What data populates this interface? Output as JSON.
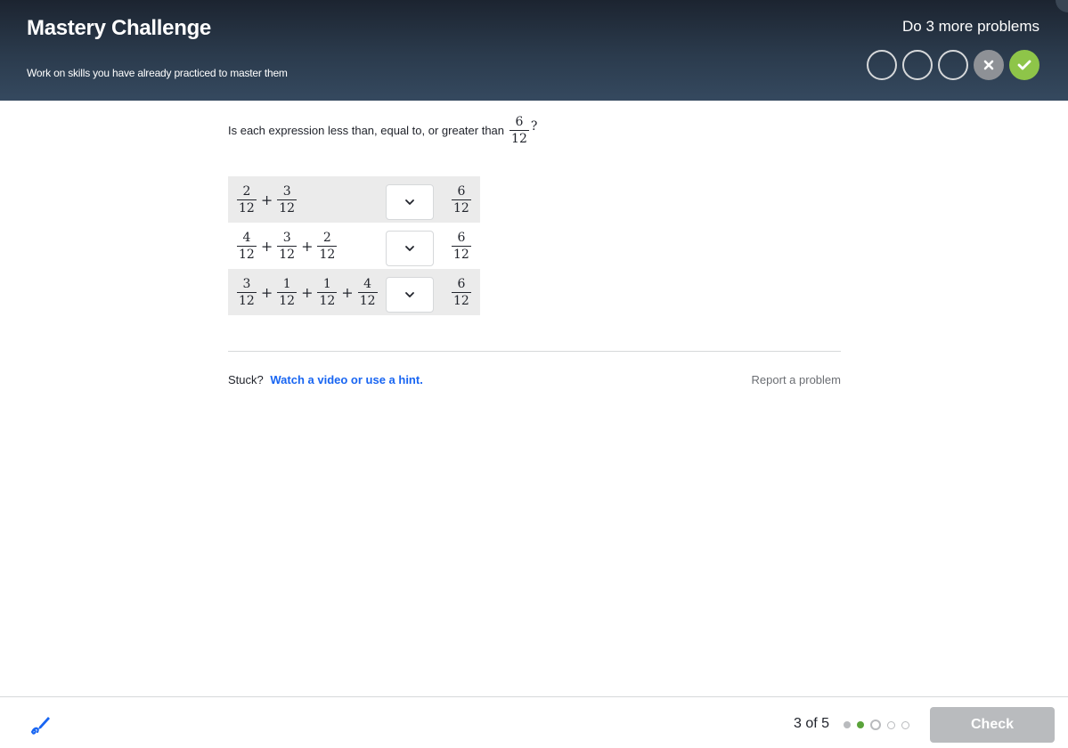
{
  "header": {
    "title": "Mastery Challenge",
    "subtitle": "Work on skills you have already practiced to master them",
    "progress_text": "Do 3 more problems",
    "dots": [
      "empty",
      "empty",
      "empty",
      "wrong",
      "correct"
    ]
  },
  "question": {
    "text": "Is each expression less than, equal to, or greater than",
    "target": {
      "num": "6",
      "den": "12"
    },
    "suffix": "?"
  },
  "rows": [
    {
      "terms": [
        {
          "num": "2",
          "den": "12"
        },
        {
          "num": "3",
          "den": "12"
        }
      ],
      "rhs": {
        "num": "6",
        "den": "12"
      },
      "selected": ""
    },
    {
      "terms": [
        {
          "num": "4",
          "den": "12"
        },
        {
          "num": "3",
          "den": "12"
        },
        {
          "num": "2",
          "den": "12"
        }
      ],
      "rhs": {
        "num": "6",
        "den": "12"
      },
      "selected": ""
    },
    {
      "terms": [
        {
          "num": "3",
          "den": "12"
        },
        {
          "num": "1",
          "den": "12"
        },
        {
          "num": "1",
          "den": "12"
        },
        {
          "num": "4",
          "den": "12"
        }
      ],
      "rhs": {
        "num": "6",
        "den": "12"
      },
      "selected": ""
    }
  ],
  "help": {
    "stuck_label": "Stuck?",
    "hint_link": "Watch a video or use a hint.",
    "report_link": "Report a problem"
  },
  "footer": {
    "counter": "3 of 5",
    "progress_dots": [
      "done",
      "correct",
      "current",
      "todo",
      "todo"
    ],
    "check_label": "Check",
    "check_color": "#b9bbbe"
  },
  "colors": {
    "accent": "#1865f2",
    "correct": "#8ec549",
    "wrong": "#8e9196"
  },
  "icons": {
    "scratchpad": "scratchpad-pencil-icon",
    "dropdown": "chevron-down-icon"
  }
}
